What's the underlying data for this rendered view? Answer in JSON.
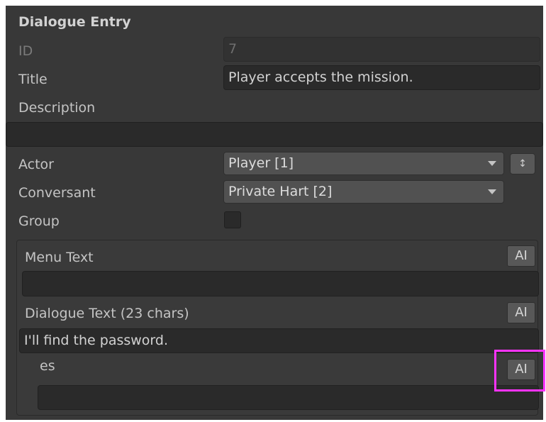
{
  "section": {
    "title": "Dialogue Entry"
  },
  "fields": {
    "id": {
      "label": "ID",
      "value": "7"
    },
    "title": {
      "label": "Title",
      "value": "Player accepts the mission."
    },
    "description": {
      "label": "Description",
      "value": ""
    },
    "actor": {
      "label": "Actor",
      "value": "Player [1]"
    },
    "conversant": {
      "label": "Conversant",
      "value": "Private Hart [2]"
    },
    "group": {
      "label": "Group",
      "checked": false
    }
  },
  "localization": {
    "menu_text": {
      "label": "Menu Text",
      "value": "",
      "ai_label": "AI"
    },
    "dialogue_text": {
      "label": "Dialogue Text (23 chars)",
      "value": "I'll find the password.",
      "ai_label": "AI"
    },
    "es": {
      "label": "es",
      "value": "",
      "ai_label": "AI"
    }
  },
  "icons": {
    "stepper": "up-down-stepper-icon",
    "dropdown": "chevron-down-icon"
  },
  "colors": {
    "panel_bg": "#383838",
    "field_bg": "#2a2a2a",
    "highlight": "#ff33ff"
  }
}
